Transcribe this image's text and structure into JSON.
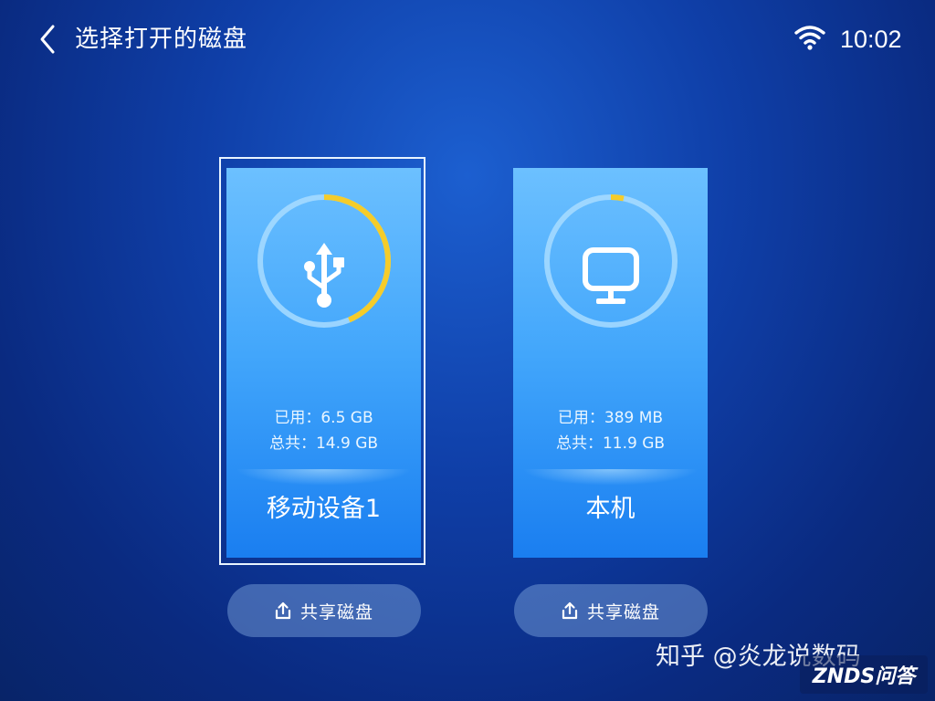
{
  "header": {
    "title": "选择打开的磁盘",
    "time": "10:02",
    "back_icon": "chevron-left-icon",
    "wifi_icon": "wifi-icon"
  },
  "disks": [
    {
      "name": "移动设备1",
      "used_text": "已用：6.5 GB",
      "total_text": "总共：14.9 GB",
      "used_fraction": 0.436,
      "icon": "usb-icon",
      "focused": true,
      "share_label": "共享磁盘"
    },
    {
      "name": "本机",
      "used_text": "已用：389 MB",
      "total_text": "总共：11.9 GB",
      "used_fraction": 0.032,
      "icon": "monitor-icon",
      "focused": false,
      "share_label": "共享磁盘"
    }
  ],
  "watermark": {
    "zhihu": "知乎 @炎龙说数码",
    "znds": "ZNDS问答"
  },
  "colors": {
    "ring_track": "#a8dcff",
    "ring_used": "#f5cc2a",
    "card_top": "#6cc0ff",
    "card_bottom": "#1a7ef0"
  }
}
